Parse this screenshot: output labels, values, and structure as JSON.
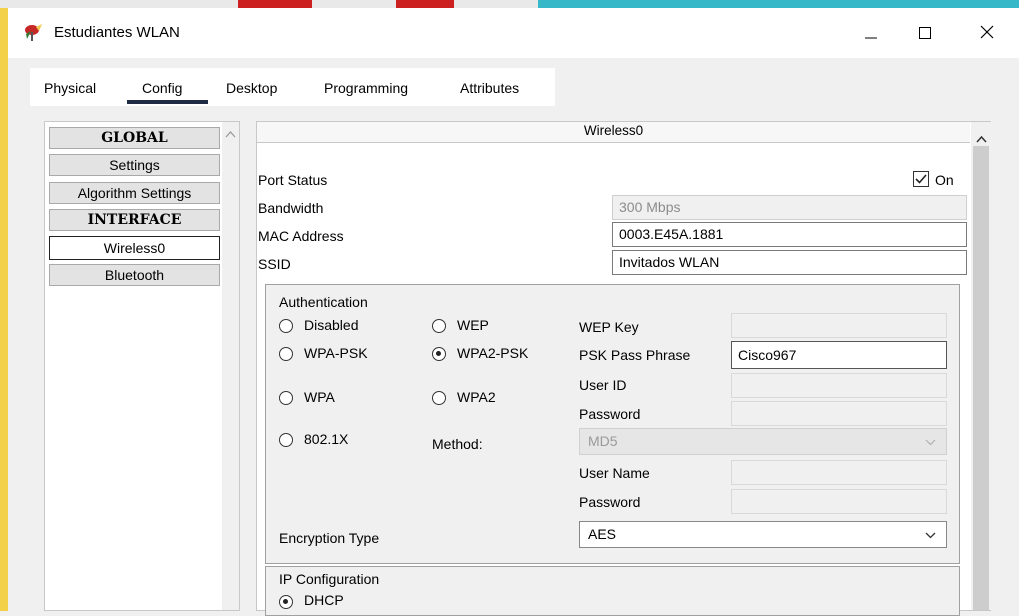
{
  "window": {
    "title": "Estudiantes WLAN"
  },
  "tabs": [
    {
      "label": "Physical"
    },
    {
      "label": "Config"
    },
    {
      "label": "Desktop"
    },
    {
      "label": "Programming"
    },
    {
      "label": "Attributes"
    }
  ],
  "active_tab": "Config",
  "sidebar": {
    "items": [
      {
        "label": "GLOBAL",
        "type": "header"
      },
      {
        "label": "Settings",
        "type": "item"
      },
      {
        "label": "Algorithm Settings",
        "type": "item"
      },
      {
        "label": "INTERFACE",
        "type": "header"
      },
      {
        "label": "Wireless0",
        "type": "item",
        "selected": true
      },
      {
        "label": "Bluetooth",
        "type": "item"
      }
    ]
  },
  "panel": {
    "title": "Wireless0",
    "port_status": {
      "label": "Port Status",
      "checkbox_label": "On",
      "checked": true
    },
    "bandwidth": {
      "label": "Bandwidth",
      "value": "300 Mbps"
    },
    "mac_address": {
      "label": "MAC Address",
      "value": "0003.E45A.1881"
    },
    "ssid": {
      "label": "SSID",
      "value": "Invitados WLAN"
    },
    "authentication": {
      "title": "Authentication",
      "options": {
        "disabled": "Disabled",
        "wep": "WEP",
        "wpa_psk": "WPA-PSK",
        "wpa2_psk": "WPA2-PSK",
        "wpa": "WPA",
        "wpa2": "WPA2",
        "dot1x": "802.1X"
      },
      "selected": "WPA2-PSK",
      "method_label": "Method:",
      "method_value": "MD5",
      "wep_key_label": "WEP Key",
      "psk_label": "PSK Pass Phrase",
      "psk_value": "Cisco967",
      "user_id_label": "User ID",
      "password_label": "Password",
      "user_name_label": "User Name",
      "password2_label": "Password"
    },
    "encryption": {
      "label": "Encryption Type",
      "value": "AES"
    },
    "ip_config": {
      "title": "IP Configuration",
      "dhcp_label": "DHCP",
      "dhcp_selected": true
    }
  },
  "colors": {
    "tab_underline": "#1f2a44",
    "title_icon_red": "#cc1f1f",
    "title_icon_green": "#3a8a3a"
  }
}
